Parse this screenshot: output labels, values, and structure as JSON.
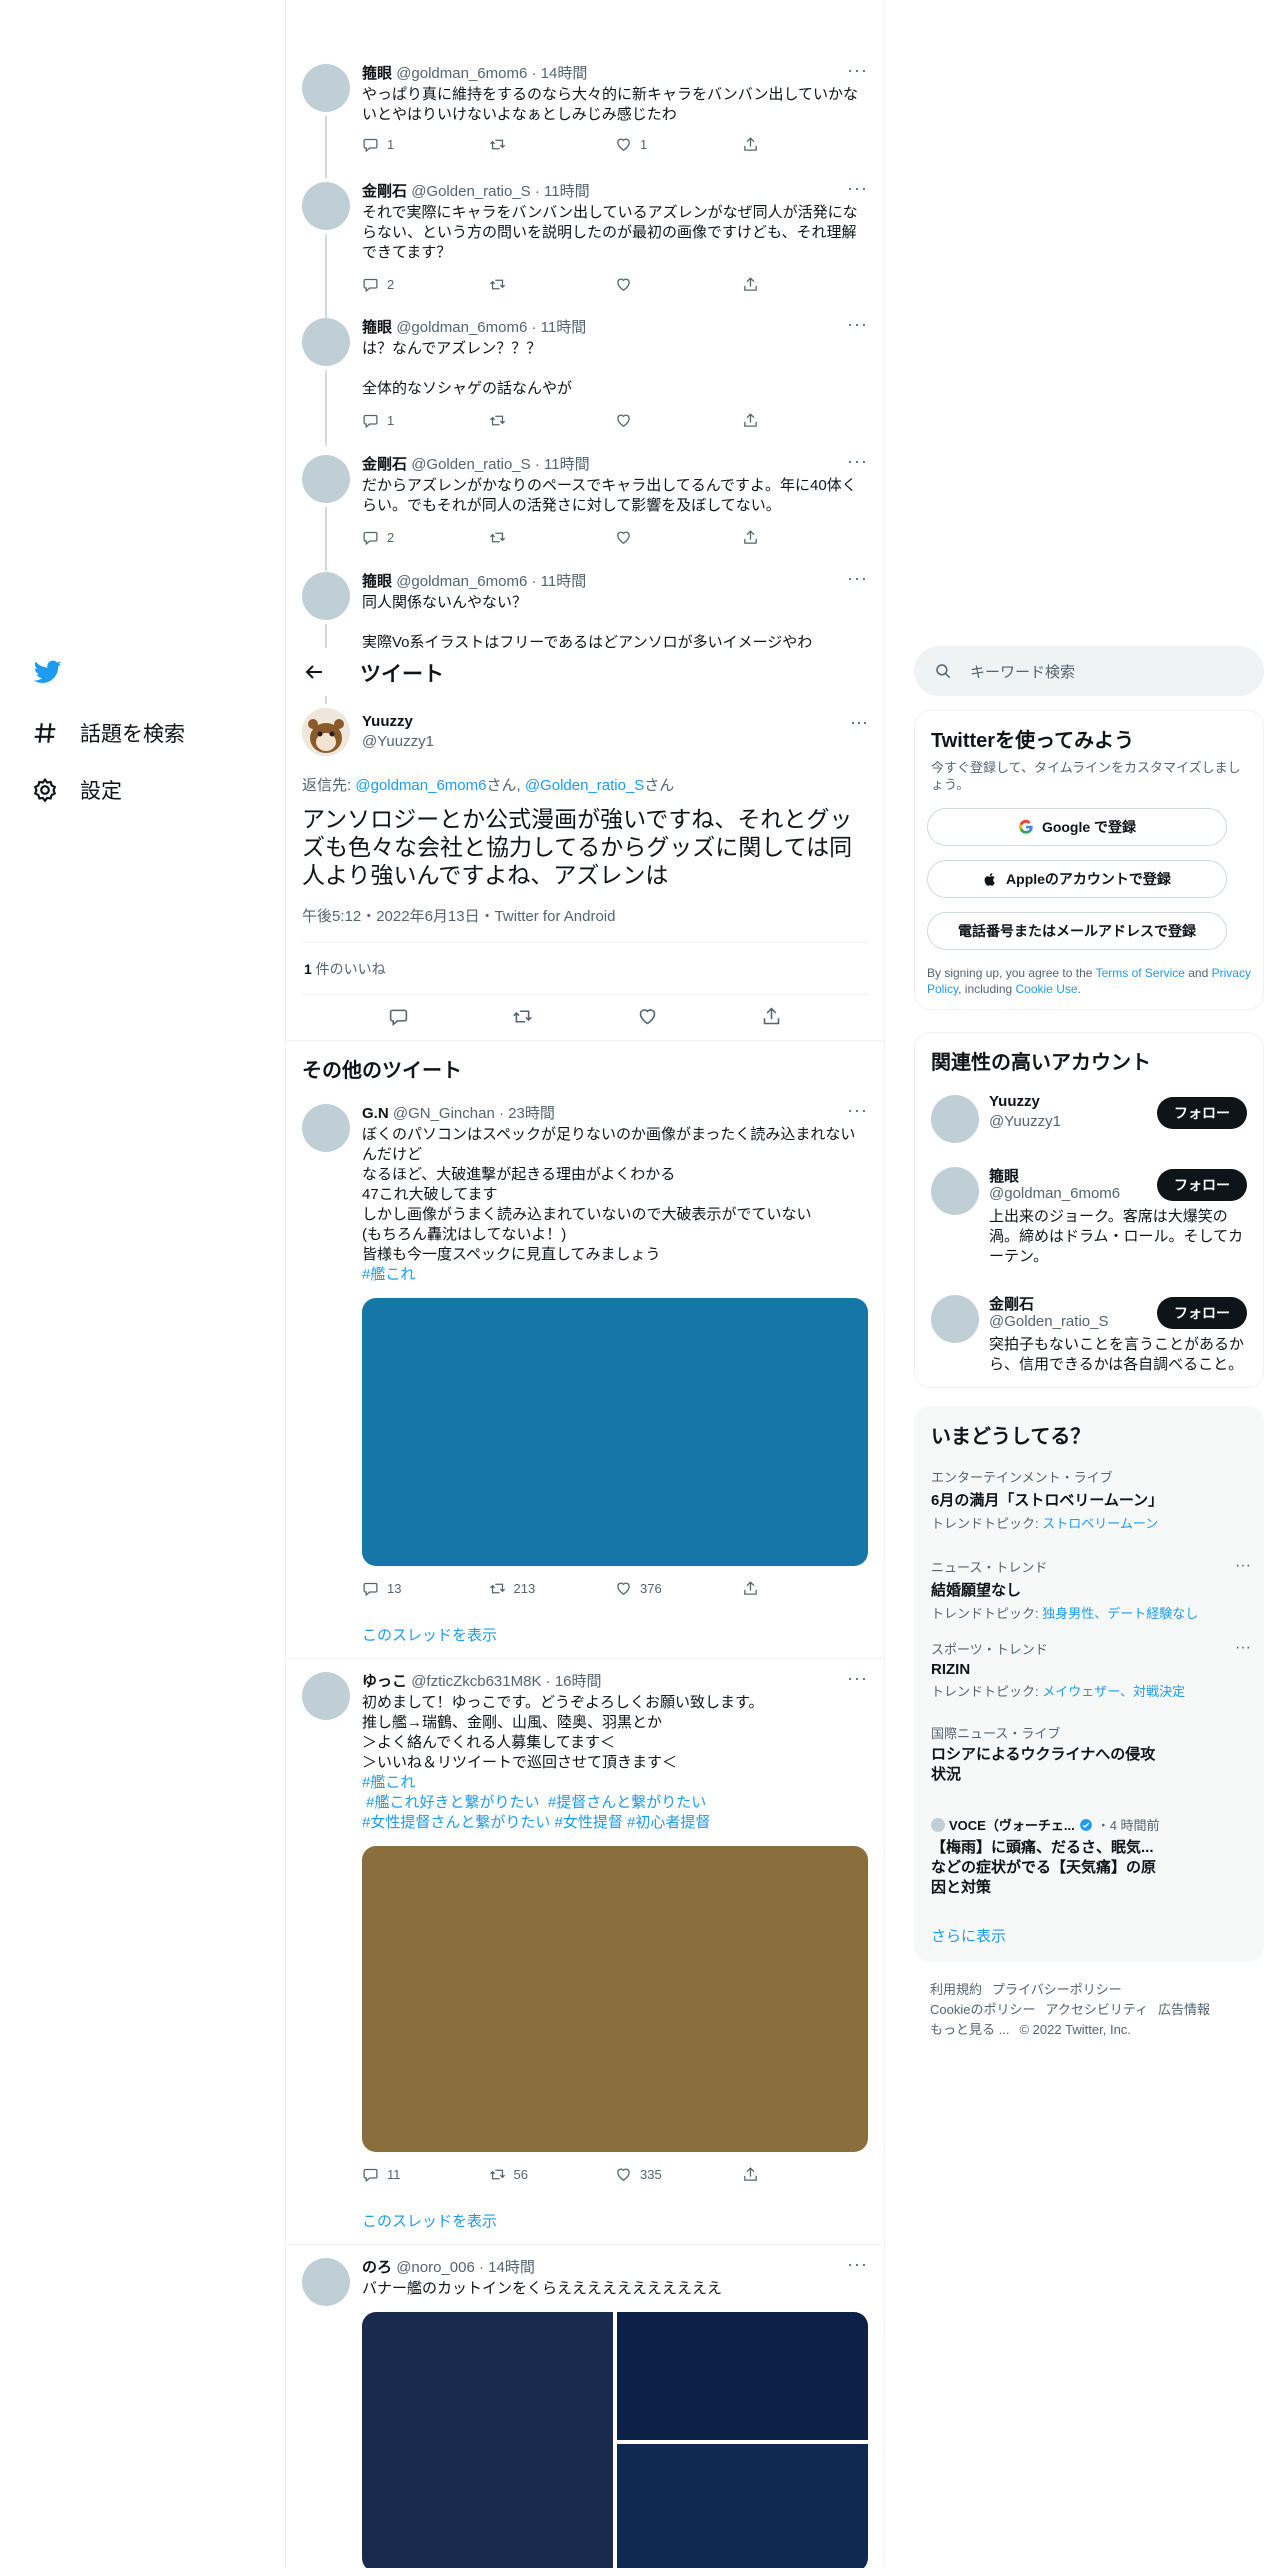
{
  "nav": {
    "explore_label": "話題を検索",
    "settings_label": "設定"
  },
  "thread": [
    {
      "name": "箍眼",
      "handle": "@goldman_6mom6",
      "time": "14時間",
      "text": "やっぱり真に維持をするのなら大々的に新キャラをバンバン出していかないとやはりいけないよなぁとしみじみ感じたわ",
      "replies": "1",
      "retweets": "",
      "likes": "1"
    },
    {
      "name": "金剛石",
      "handle": "@Golden_ratio_S",
      "time": "11時間",
      "text": "それで実際にキャラをバンバン出しているアズレンがなぜ同人が活発にならない、という方の問いを説明したのが最初の画像ですけども、それ理解できてます？",
      "replies": "2",
      "retweets": "",
      "likes": ""
    },
    {
      "name": "箍眼",
      "handle": "@goldman_6mom6",
      "time": "11時間",
      "text": "は？なんでアズレン？？？\n\n全体的なソシャゲの話なんやが",
      "replies": "1",
      "retweets": "",
      "likes": ""
    },
    {
      "name": "金剛石",
      "handle": "@Golden_ratio_S",
      "time": "11時間",
      "text": "だからアズレンがかなりのペースでキャラ出してるんですよ。年に40体くらい。でもそれが同人の活発さに対して影響を及ぼしてない。",
      "replies": "2",
      "retweets": "",
      "likes": ""
    },
    {
      "name": "箍眼",
      "handle": "@goldman_6mom6",
      "time": "11時間",
      "text": "同人関係ないんやない？\n\n実際Vo系イラストはフリーであるはどアンソロが多いイメージやわ",
      "replies": "",
      "retweets": "",
      "likes": ""
    }
  ],
  "header": {
    "title": "ツイート"
  },
  "main_tweet": {
    "name": "Yuuzzy",
    "handle": "@Yuuzzy1",
    "reply_prefix": "返信先: ",
    "reply_user1": "@goldman_6mom6",
    "reply_mid": "さん, ",
    "reply_user2": "@Golden_ratio_S",
    "reply_suffix": "さん",
    "text": "アンソロジーとか公式漫画が強いですね、それとグッズも色々な会社と協力してるからグッズに関しては同人より強いんですよね、アズレンは",
    "meta": "午後5:12・2022年6月13日・Twitter for Android",
    "likes_count": "1",
    "likes_label": " 件のいいね"
  },
  "more_tweets": {
    "title": "その他のツイート",
    "show_thread": "このスレッドを表示",
    "items": [
      {
        "name": "G.N",
        "handle": "@GN_Ginchan",
        "time": "23時間",
        "text": "ぼくのパソコンはスペックが足りないのか画像がまったく読み込まれないんだけど\nなるほど、大破進撃が起きる理由がよくわかる\n47これ大破してます\nしかし画像がうまく読み込まれていないので大破表示がでていない\n(もちろん轟沈はしてないよ！)\n皆様も今一度スペックに見直してみましょう",
        "tags": "#艦これ",
        "replies": "13",
        "retweets": "213",
        "likes": "376",
        "media_color": "#1776a8"
      },
      {
        "name": "ゆっこ",
        "handle": "@fzticZkcb631M8K",
        "time": "16時間",
        "text": "初めまして！ゆっこです。どうぞよろしくお願い致します。\n推し艦→瑞鶴、金剛、山風、陸奥、羽黒とか\n＞よく絡んでくれる人募集してます＜\n＞いいね＆リツイートで巡回させて頂きます＜",
        "tags": "#艦これ\n #艦これ好きと繋がりたい  #提督さんと繋がりたい\n#女性提督さんと繋がりたい #女性提督 #初心者提督",
        "replies": "11",
        "retweets": "56",
        "likes": "335",
        "media_color": "#8a6e3c"
      },
      {
        "name": "のろ",
        "handle": "@noro_006",
        "time": "14時間",
        "text": "バナー艦のカットインをくらえええええええええええ",
        "tags": "",
        "replies": "",
        "retweets": "",
        "likes": "",
        "media_colors": [
          "#1a2a4e",
          "#0d2148",
          "#0e2a52"
        ]
      }
    ]
  },
  "search": {
    "placeholder": "キーワード検索"
  },
  "signup": {
    "title": "Twitterを使ってみよう",
    "desc": "今すぐ登録して、タイムラインをカスタマイズしましょう。",
    "google": "Google で登録",
    "apple": "Appleのアカウントで登録",
    "phone": "電話番号またはメールアドレスで登録",
    "terms_pre": "By signing up, you agree to the ",
    "terms": "Terms of Service",
    "terms_and": " and ",
    "privacy": "Privacy Policy",
    "terms_incl": ", including ",
    "cookie": "Cookie Use",
    "terms_end": "."
  },
  "related": {
    "title": "関連性の高いアカウント",
    "follow": "フォロー",
    "accounts": [
      {
        "name": "Yuuzzy",
        "handle": "@Yuuzzy1",
        "bio": ""
      },
      {
        "name": "箍眼",
        "handle": "@goldman_6mom6",
        "bio": "上出来のジョーク。客席は大爆笑の渦。締めはドラム・ロール。そしてカーテン。"
      },
      {
        "name": "金剛石",
        "handle": "@Golden_ratio_S",
        "bio": "突拍子もないことを言うことがあるから、信用できるかは各自調べること。"
      }
    ]
  },
  "trends": {
    "title": "いまどうしてる？",
    "items": [
      {
        "cat": "エンターテインメント・ライブ",
        "name": "6月の満月「ストロベリームーン」",
        "sub_label": "トレンドトピック: ",
        "sub": "ストロベリームーン"
      },
      {
        "cat": "ニュース・トレンド",
        "name": "結婚願望なし",
        "sub_label": "トレンドトピック: ",
        "sub": "独身男性、デート経験なし"
      },
      {
        "cat": "スポーツ・トレンド",
        "name": "RIZIN",
        "sub_label": "トレンドトピック: ",
        "sub": "メイウェザー、対戦決定"
      },
      {
        "cat": "国際ニュース・ライブ",
        "name": "ロシアによるウクライナへの侵攻状況",
        "sub_label": "",
        "sub": ""
      }
    ],
    "news_source": "VOCE（ヴォーチェ...",
    "news_time": "・4 時間前",
    "news_title": "【梅雨】に頭痛、だるさ、眠気...などの症状がでる【天気痛】の原因と対策",
    "show_more": "さらに表示"
  },
  "footer": {
    "line1": [
      "利用規約",
      "プライバシーポリシー"
    ],
    "line2": [
      "Cookieのポリシー",
      "アクセシビリティ",
      "広告情報"
    ],
    "line3": [
      "もっと見る ...",
      "© 2022 Twitter, Inc."
    ]
  }
}
